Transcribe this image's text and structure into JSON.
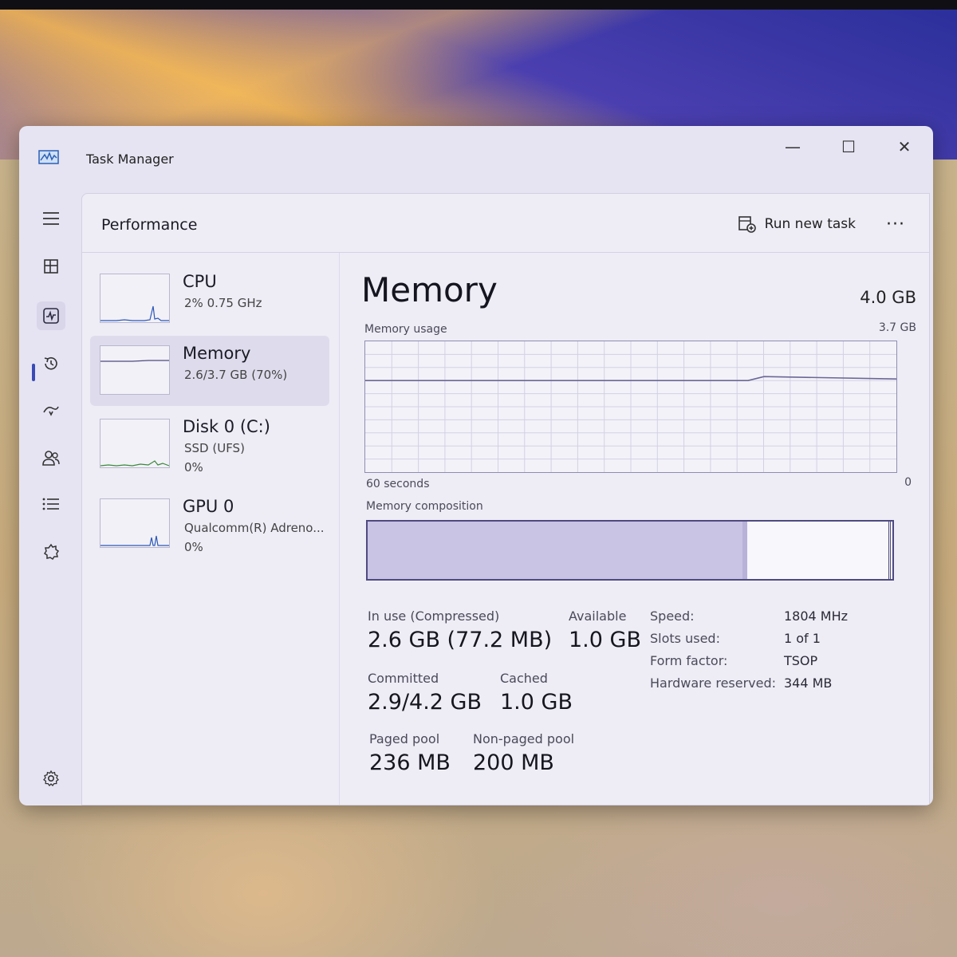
{
  "window": {
    "title": "Task Manager"
  },
  "window_controls": {
    "minimize": "—",
    "maximize": "☐",
    "close": "✕"
  },
  "header": {
    "title": "Performance",
    "run_new_task": "Run new task",
    "more": "···"
  },
  "nav": {
    "items": [
      {
        "name": "hamburger-menu-icon",
        "glyph": "☰"
      },
      {
        "name": "processes-icon",
        "glyph": "▦"
      },
      {
        "name": "performance-icon",
        "glyph": "〰",
        "active": true
      },
      {
        "name": "app-history-icon",
        "glyph": "⟲"
      },
      {
        "name": "startup-apps-icon",
        "glyph": "⤴"
      },
      {
        "name": "users-icon",
        "glyph": "👥"
      },
      {
        "name": "details-icon",
        "glyph": "≣"
      },
      {
        "name": "services-icon",
        "glyph": "⚙"
      },
      {
        "name": "settings-icon",
        "glyph": "⚙"
      }
    ]
  },
  "perf_list": [
    {
      "name": "CPU",
      "sub": "2%  0.75 GHz",
      "sub2": ""
    },
    {
      "name": "Memory",
      "sub": "2.6/3.7 GB (70%)",
      "sub2": ""
    },
    {
      "name": "Disk 0 (C:)",
      "sub": "SSD (UFS)",
      "sub2": "0%"
    },
    {
      "name": "GPU 0",
      "sub": "Qualcomm(R) Adreno...",
      "sub2": "0%"
    }
  ],
  "memory": {
    "title": "Memory",
    "total": "4.0 GB",
    "usage_label": "Memory usage",
    "usage_max": "3.7 GB",
    "time_left": "60 seconds",
    "time_right": "0",
    "composition_label": "Memory composition",
    "composition": {
      "in_use_fraction": 0.715,
      "modified_fraction": 0.008,
      "free_fraction": 0.27
    },
    "usage_fraction": 0.7,
    "stats": {
      "in_use_label": "In use (Compressed)",
      "in_use_value": "2.6 GB (77.2 MB)",
      "available_label": "Available",
      "available_value": "1.0 GB",
      "committed_label": "Committed",
      "committed_value": "2.9/4.2 GB",
      "cached_label": "Cached",
      "cached_value": "1.0 GB",
      "paged_label": "Paged pool",
      "paged_value": "236 MB",
      "nonpaged_label": "Non-paged pool",
      "nonpaged_value": "200 MB"
    },
    "specs": {
      "speed_label": "Speed:",
      "speed_value": "1804 MHz",
      "slots_label": "Slots used:",
      "slots_value": "1 of 1",
      "form_label": "Form factor:",
      "form_value": "TSOP",
      "reserved_label": "Hardware reserved:",
      "reserved_value": "344 MB"
    }
  },
  "colors": {
    "accent": "#3a4bb7",
    "graph_line": "#6a6796",
    "composition_fill": "#c9c3e4",
    "composition_border": "#4e4a80"
  }
}
